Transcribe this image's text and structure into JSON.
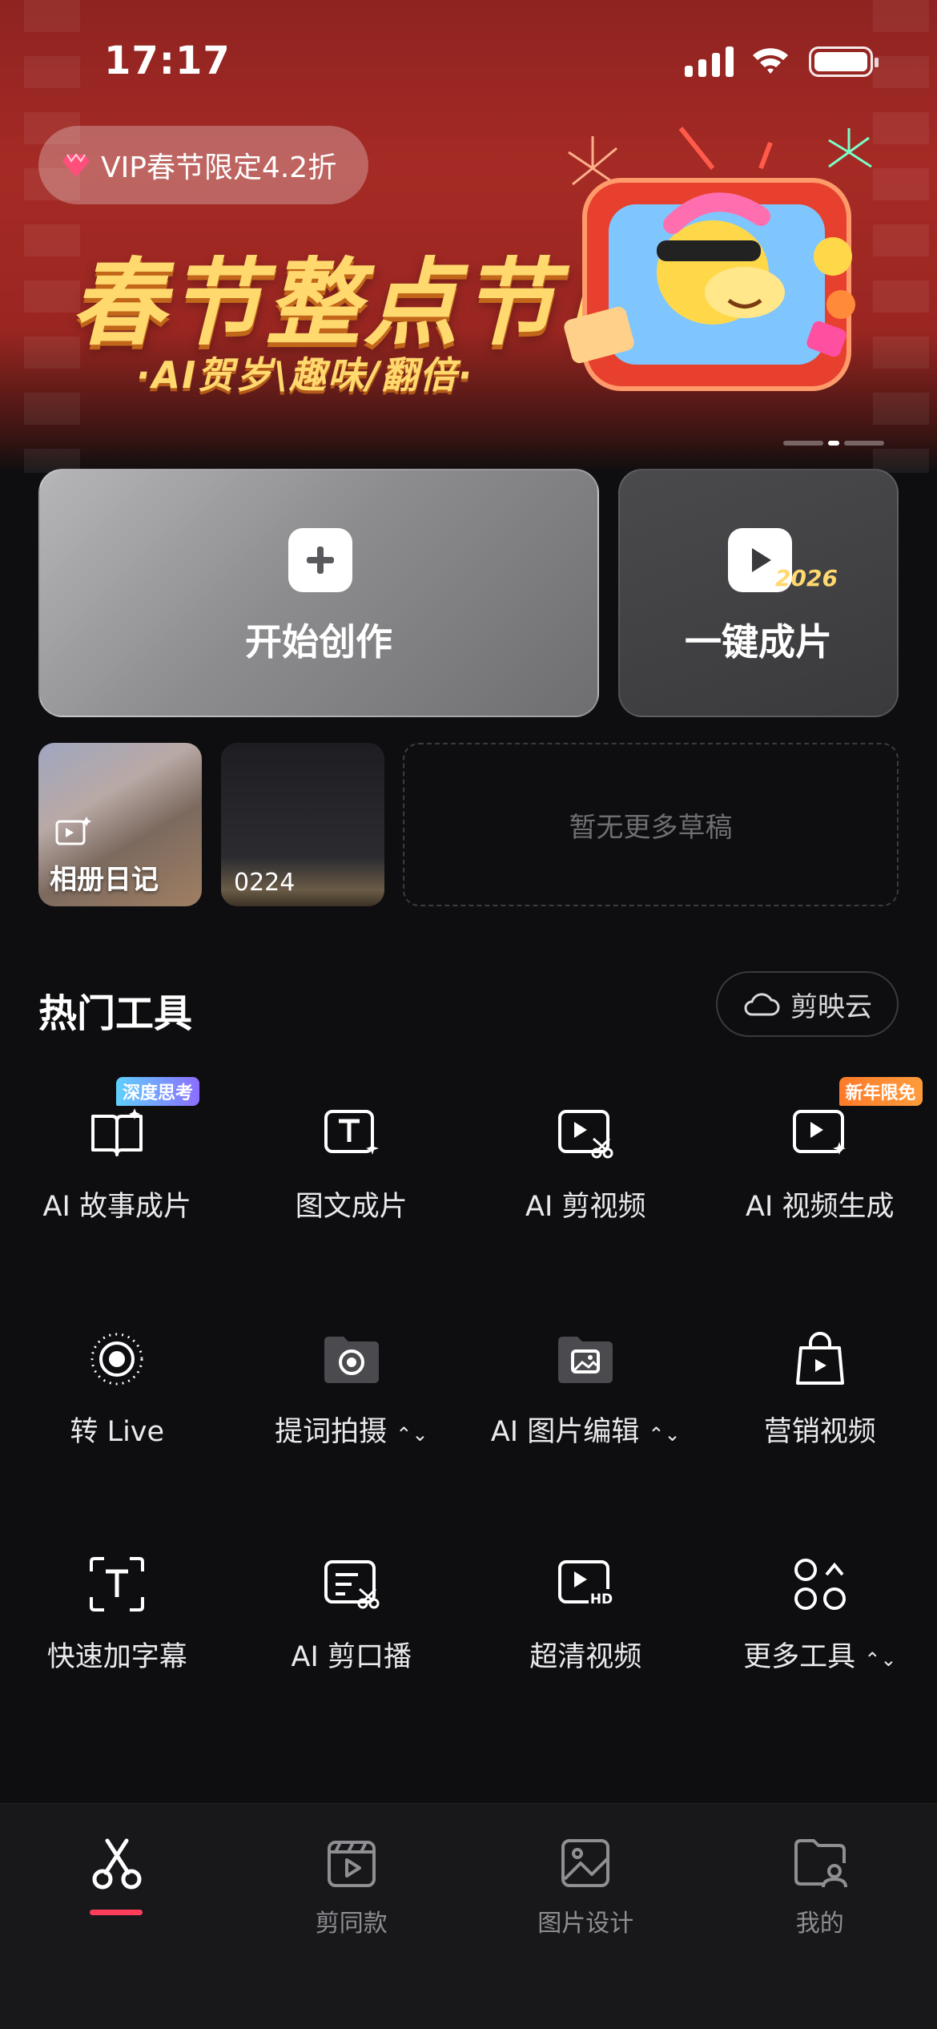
{
  "status_bar": {
    "time": "17:17"
  },
  "banner": {
    "vip_label": "VIP春节限定4.2折",
    "title": "春节整点节目",
    "subtitle": "·AI贺岁\\趣味/翻倍·",
    "year_on_tv": "2026"
  },
  "actions": {
    "create_label": "开始创作",
    "quick_label": "一键成片",
    "quick_year": "2026"
  },
  "drafts": {
    "items": [
      {
        "label": "相册日记"
      },
      {
        "label": "0224"
      }
    ],
    "empty_label": "暂无更多草稿"
  },
  "tools_section": {
    "title": "热门工具",
    "cloud_label": "剪映云",
    "tools": [
      {
        "label": "AI 故事成片",
        "icon": "book-sparkle-icon",
        "badge": "深度思考"
      },
      {
        "label": "图文成片",
        "icon": "text-box-sparkle-icon"
      },
      {
        "label": "AI 剪视频",
        "icon": "video-scissors-icon"
      },
      {
        "label": "AI 视频生成",
        "icon": "video-sparkle-icon",
        "badge": "新年限免"
      },
      {
        "label": "转 Live",
        "icon": "live-photo-icon"
      },
      {
        "label": "提词拍摄",
        "icon": "teleprompter-camera-icon",
        "has_chevron": true
      },
      {
        "label": "AI 图片编辑",
        "icon": "image-folder-icon",
        "has_chevron": true
      },
      {
        "label": "营销视频",
        "icon": "shopping-bag-play-icon"
      },
      {
        "label": "快速加字幕",
        "icon": "subtitle-frame-icon"
      },
      {
        "label": "AI 剪口播",
        "icon": "text-scissors-icon"
      },
      {
        "label": "超清视频",
        "icon": "hd-video-icon"
      },
      {
        "label": "更多工具",
        "icon": "more-tools-icon",
        "has_chevron": true
      }
    ]
  },
  "tab_bar": {
    "tabs": [
      {
        "label": "",
        "icon": "scissors-icon",
        "active": true
      },
      {
        "label": "剪同款",
        "icon": "clapper-icon"
      },
      {
        "label": "图片设计",
        "icon": "image-design-icon"
      },
      {
        "label": "我的",
        "icon": "profile-folder-icon"
      }
    ]
  },
  "colors": {
    "accent": "#ff3d5a",
    "banner_red": "#a52a25",
    "title_gold": "#ffd86e",
    "background": "#0e0e10"
  }
}
